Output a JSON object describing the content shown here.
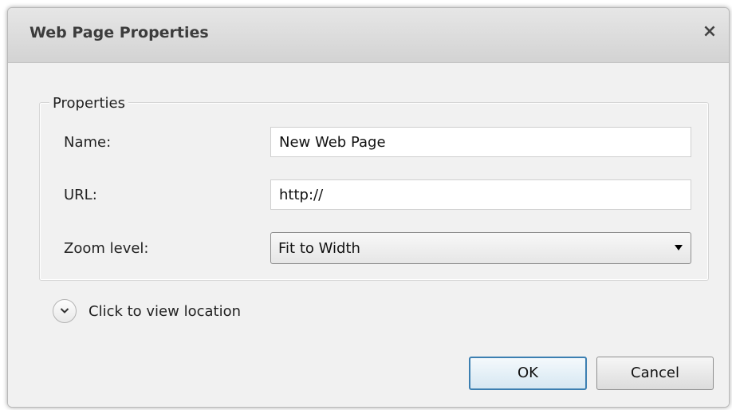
{
  "dialog": {
    "title": "Web Page Properties",
    "close_label": "×"
  },
  "properties": {
    "group_label": "Properties",
    "name_label": "Name:",
    "name_value": "New Web Page",
    "url_label": "URL:",
    "url_value": "http://",
    "zoom_label": "Zoom level:",
    "zoom_value": "Fit to Width"
  },
  "location": {
    "expander_label": "Click to view location"
  },
  "buttons": {
    "ok_label": "OK",
    "cancel_label": "Cancel"
  }
}
